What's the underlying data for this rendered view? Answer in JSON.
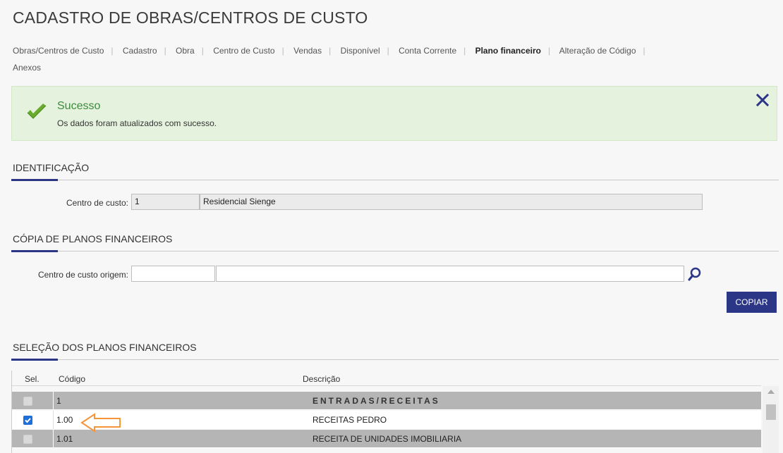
{
  "page": {
    "title": "CADASTRO DE OBRAS/CENTROS DE CUSTO"
  },
  "tabs": [
    {
      "label": "Obras/Centros de Custo",
      "active": false
    },
    {
      "label": "Cadastro",
      "active": false
    },
    {
      "label": "Obra",
      "active": false
    },
    {
      "label": "Centro de Custo",
      "active": false
    },
    {
      "label": "Vendas",
      "active": false
    },
    {
      "label": "Disponível",
      "active": false
    },
    {
      "label": "Conta Corrente",
      "active": false
    },
    {
      "label": "Plano financeiro",
      "active": true
    },
    {
      "label": "Alteração de Código",
      "active": false
    },
    {
      "label": "Anexos",
      "active": false
    }
  ],
  "alert": {
    "title": "Sucesso",
    "message": "Os dados foram atualizados com sucesso.",
    "icon": "check-icon",
    "close_icon": "close-icon",
    "color": "#e4f2de"
  },
  "identificacao": {
    "section_title": "IDENTIFICAÇÃO",
    "label": "Centro de custo:",
    "code": "1",
    "name": "Residencial Sienge"
  },
  "copia": {
    "section_title": "CÓPIA DE PLANOS FINANCEIROS",
    "label": "Centro de custo origem:",
    "code": "",
    "name": "",
    "search_icon": "search-icon",
    "button": "COPIAR"
  },
  "selecao": {
    "section_title": "SELEÇÃO DOS PLANOS FINANCEIROS",
    "columns": {
      "sel": "Sel.",
      "codigo": "Código",
      "descricao": "Descrição"
    },
    "rows": [
      {
        "checked": false,
        "codigo": "1",
        "descricao": "ENTRADAS/RECEITAS",
        "style": "grey"
      },
      {
        "checked": true,
        "codigo": "1.00",
        "descricao": "RECEITAS PEDRO",
        "style": "white"
      },
      {
        "checked": false,
        "codigo": "1.01",
        "descricao": "RECEITA DE UNIDADES IMOBILIARIA",
        "style": "grey"
      }
    ]
  },
  "colors": {
    "accent": "#2b3687",
    "success_text": "#3d8b3d",
    "annotation_arrow": "#f5953a"
  }
}
